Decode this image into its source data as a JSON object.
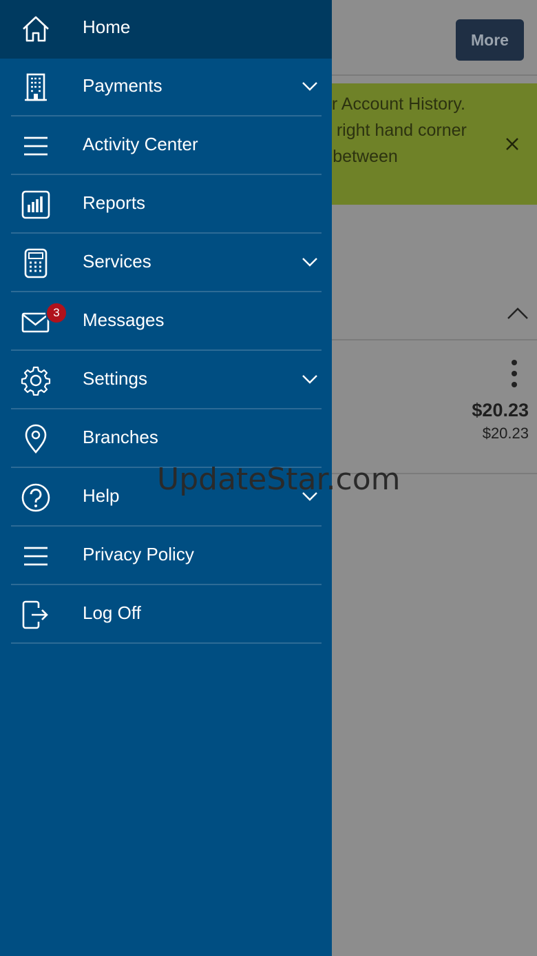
{
  "header": {
    "more_label": "More"
  },
  "banner": {
    "lines": [
      "ur Account History.",
      "e right hand corner",
      "r between"
    ],
    "close_icon": "close-icon"
  },
  "account": {
    "amount_primary": "$20.23",
    "amount_secondary": "$20.23"
  },
  "nav": {
    "items": [
      {
        "label": "Home",
        "icon": "home-icon"
      },
      {
        "label": "Payments",
        "icon": "building-icon",
        "expandable": true
      },
      {
        "label": "Activity Center",
        "icon": "list-icon"
      },
      {
        "label": "Reports",
        "icon": "bar-chart-icon"
      },
      {
        "label": "Services",
        "icon": "calculator-icon",
        "expandable": true
      },
      {
        "label": "Messages",
        "icon": "envelope-icon",
        "badge": "3"
      },
      {
        "label": "Settings",
        "icon": "gear-icon",
        "expandable": true
      },
      {
        "label": "Branches",
        "icon": "location-pin-icon"
      },
      {
        "label": "Help",
        "icon": "question-icon",
        "expandable": true
      },
      {
        "label": "Privacy Policy",
        "icon": "list-icon"
      },
      {
        "label": "Log Off",
        "icon": "logout-icon"
      }
    ]
  },
  "watermark": "UpdateStar.com",
  "colors": {
    "drawer": "#004e82",
    "drawer_active": "#003a60",
    "banner": "#6f8228",
    "badge": "#b0121c"
  }
}
